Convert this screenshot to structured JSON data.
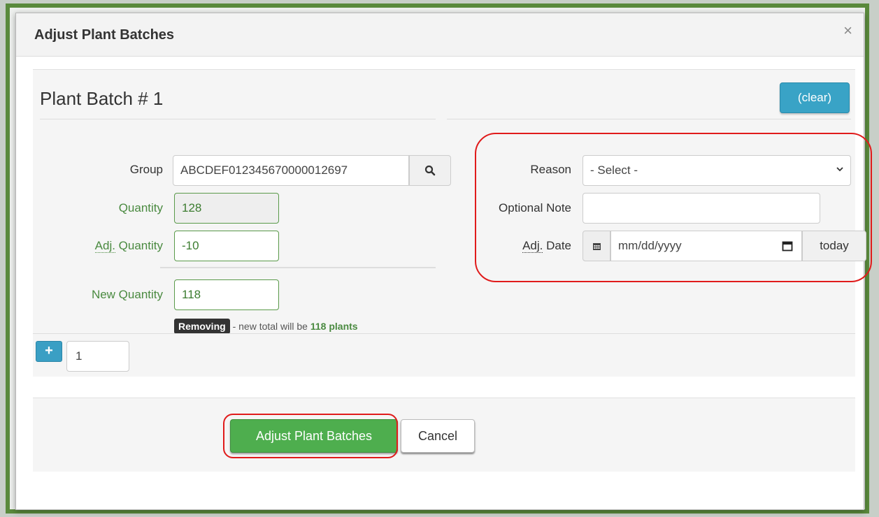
{
  "modal": {
    "title": "Adjust Plant Batches",
    "close_label": "×"
  },
  "batch": {
    "title": "Plant Batch # 1",
    "clear_label": "(clear)"
  },
  "fields": {
    "group_label": "Group",
    "group_value": "ABCDEF012345670000012697",
    "quantity_label": "Quantity",
    "quantity_value": "128",
    "adj_abbr": "Adj.",
    "adj_quantity_label": " Quantity",
    "adj_quantity_value": "-10",
    "new_quantity_label": "New Quantity",
    "new_quantity_value": "118",
    "hint_badge": "Removing",
    "hint_text": " - new total will be ",
    "hint_highlight": "118 plants",
    "reason_label": "Reason",
    "reason_value": "- Select -",
    "note_label": "Optional Note",
    "note_value": "",
    "adj_date_abbr": "Adj.",
    "adj_date_label": " Date",
    "date_placeholder": "mm/dd/yyyy",
    "today_label": "today"
  },
  "add_row": {
    "plus_label": "+",
    "count_value": "1"
  },
  "footer": {
    "submit_label": "Adjust Plant Batches",
    "cancel_label": "Cancel"
  },
  "colors": {
    "accent_blue": "#39a3c6",
    "submit_green": "#4eae4e",
    "field_green": "#4a8a40",
    "highlight_red": "#e01b1b",
    "frame_green": "#5a8a3c"
  }
}
